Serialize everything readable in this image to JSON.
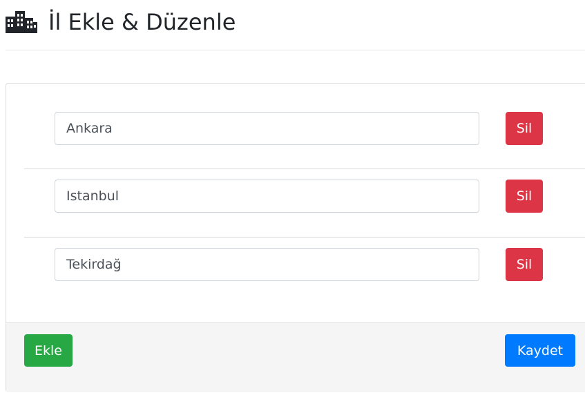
{
  "header": {
    "icon": "city-icon",
    "title": "İl Ekle & Düzenle"
  },
  "cities": [
    {
      "value": "Ankara",
      "delete_label": "Sil"
    },
    {
      "value": "Istanbul",
      "delete_label": "Sil"
    },
    {
      "value": "Tekirdağ",
      "delete_label": "Sil"
    }
  ],
  "footer": {
    "add_label": "Ekle",
    "save_label": "Kaydet"
  },
  "colors": {
    "danger": "#dc3545",
    "success": "#28a745",
    "primary": "#007bff"
  }
}
